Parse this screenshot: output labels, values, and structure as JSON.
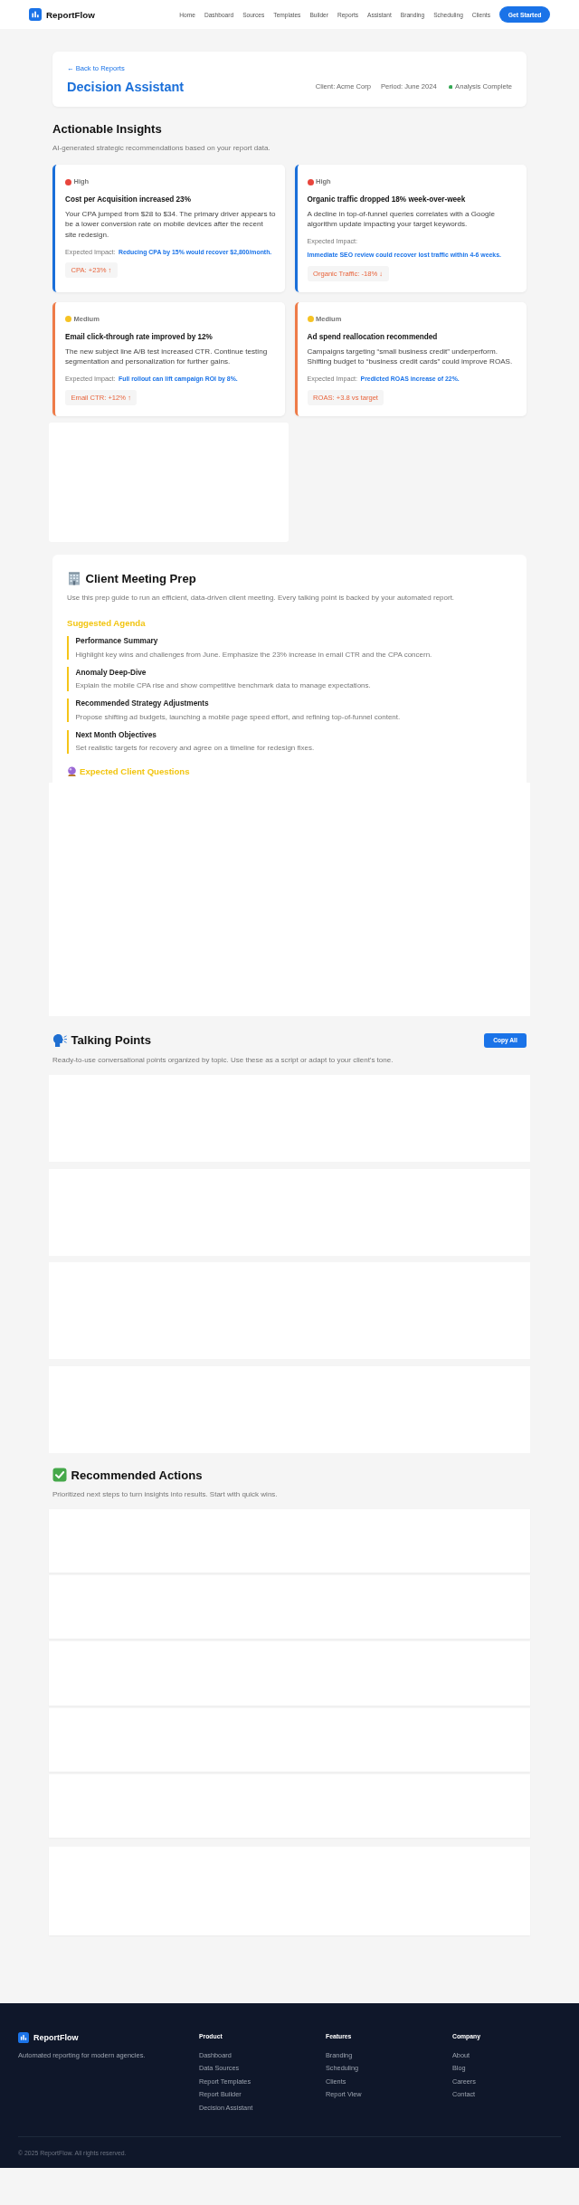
{
  "nav": {
    "brand": "ReportFlow",
    "links": [
      {
        "label": "Home",
        "selected": false
      },
      {
        "label": "Dashboard",
        "selected": false
      },
      {
        "label": "Sources",
        "selected": false
      },
      {
        "label": "Templates",
        "selected": false
      },
      {
        "label": "Builder",
        "selected": false
      },
      {
        "label": "Reports",
        "selected": false
      },
      {
        "label": "Assistant",
        "selected": false
      },
      {
        "label": "Branding",
        "selected": false
      },
      {
        "label": "Scheduling",
        "selected": false
      },
      {
        "label": "Clients",
        "selected": false
      }
    ],
    "cta": "Get Started"
  },
  "page_header": {
    "back_link": "← Back to Reports",
    "title": "Decision Assistant",
    "client": "Client: Acme Corp",
    "period": "Period: June 2024",
    "status": {
      "label": "Analysis Complete",
      "complete": true
    }
  },
  "insights": {
    "title": "Actionable Insights",
    "description": "AI-generated strategic recommendations based on your report data.",
    "items": [
      {
        "kind": "high",
        "priority_label": "High",
        "title": "Cost per Acquisition increased 23%",
        "description": "Your CPA jumped from $28 to $34. The primary driver appears to be a lower conversion rate on mobile devices after the recent site redesign.",
        "impact_label": "Expected Impact:",
        "impact": "Reducing CPA by 15% would recover $2,800/month.",
        "metric": "CPA: +23% ↑"
      },
      {
        "kind": "high",
        "priority_label": "High",
        "title": "Organic traffic dropped 18% week-over-week",
        "description": "A decline in top-of-funnel queries correlates with a Google algorithm update impacting your target keywords.",
        "impact_label": "Expected Impact:",
        "impact": "Immediate SEO review could recover lost traffic within 4-6 weeks.",
        "metric": "Organic Traffic: -18% ↓"
      },
      {
        "kind": "medium",
        "priority_label": "Medium",
        "title": "Email click-through rate improved by 12%",
        "description": "The new subject line A/B test increased CTR. Continue testing segmentation and personalization for further gains.",
        "impact_label": "Expected Impact:",
        "impact": "Full rollout can lift campaign ROI by 8%.",
        "metric": "Email CTR: +12% ↑"
      },
      {
        "kind": "medium",
        "priority_label": "Medium",
        "title": "Ad spend reallocation recommended",
        "description": "Campaigns targeting “small business credit” underperform. Shifting budget to “business credit cards” could improve ROAS.",
        "impact_label": "Expected Impact:",
        "impact": "Predicted ROAS increase of 22%.",
        "metric": "ROAS: +3.8 vs target"
      },
      {
        "kind": "blank"
      }
    ]
  },
  "meeting_prep": {
    "title": "Client Meeting Prep",
    "description": "Use this prep guide to run an efficient, data-driven client meeting. Every talking point is backed by your automated report.",
    "agenda_title": "Suggested Agenda",
    "agenda": [
      {
        "title": "Performance Summary",
        "description": "Highlight key wins and challenges from June. Emphasize the 23% increase in email CTR and the CPA concern."
      },
      {
        "title": "Anomaly Deep-Dive",
        "description": "Explain the mobile CPA rise and show competitive benchmark data to manage expectations."
      },
      {
        "title": "Recommended Strategy Adjustments",
        "description": "Propose shifting ad budgets, launching a mobile page speed effort, and refining top-of-funnel content."
      },
      {
        "title": "Next Month Objectives",
        "description": "Set realistic targets for recovery and agree on a timeline for redesign fixes."
      }
    ],
    "questions_title": "Expected Client Questions",
    "questions": [
      {
        "kind": "blank"
      }
    ]
  },
  "talking_points": {
    "title": "Talking Points",
    "description": "Ready-to-use conversational points organized by topic. Use these as a script or adapt to your client's tone.",
    "copy_button": "Copy All",
    "cards": [
      {
        "kind": "blank"
      },
      {
        "kind": "blank"
      },
      {
        "kind": "tall"
      },
      {
        "kind": "blank"
      }
    ]
  },
  "recommended_actions": {
    "title": "Recommended Actions",
    "description": "Prioritized next steps to turn insights into results. Start with quick wins.",
    "cards": [
      {
        "kind": "blank"
      },
      {
        "kind": "blank"
      },
      {
        "kind": "blank"
      },
      {
        "kind": "blank"
      },
      {
        "kind": "blank"
      },
      {
        "kind": "tall"
      }
    ]
  },
  "footer": {
    "brand": "ReportFlow",
    "tagline": "Automated reporting for modern agencies.",
    "columns": [
      {
        "title": "Product",
        "links": [
          "Dashboard",
          "Data Sources",
          "Report Templates",
          "Report Builder",
          "Decision Assistant"
        ]
      },
      {
        "title": "Features",
        "links": [
          "Branding",
          "Scheduling",
          "Clients",
          "Report View"
        ]
      },
      {
        "title": "Company",
        "links": [
          "About",
          "Blog",
          "Careers",
          "Contact"
        ]
      }
    ],
    "copyright": "© 2025 ReportFlow. All rights reserved."
  }
}
